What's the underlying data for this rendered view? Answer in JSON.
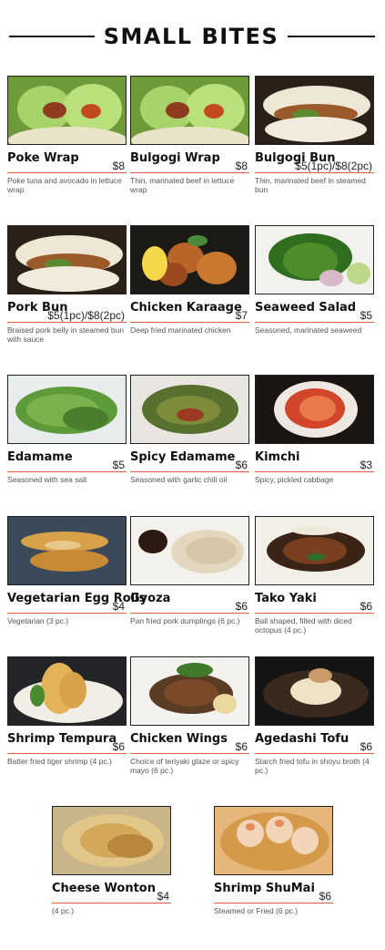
{
  "header": {
    "title": "SMALL BITES"
  },
  "items": [
    {
      "name": "Poke Wrap",
      "price": "$8",
      "desc": "Poke tuna and avocado in lettuce wrap",
      "photo": "lettuce-wraps-photo"
    },
    {
      "name": "Bulgogi Wrap",
      "price": "$8",
      "desc": "Thin, marinated beef in lettuce wrap",
      "photo": "lettuce-wraps-photo"
    },
    {
      "name": "Bulgogi Bun",
      "price": "$5(1pc)/$8(2pc)",
      "desc": "Thin, marinated beef in steamed bun",
      "photo": "steamed-bun-photo"
    },
    {
      "name": "Pork Bun",
      "price": "$5(1pc)/$8(2pc)",
      "desc": "Braised pork belly in steamed bun with sauce",
      "photo": "steamed-bun-photo"
    },
    {
      "name": "Chicken Karaage",
      "price": "$7",
      "desc": "Deep fried marinated chicken",
      "photo": "fried-chicken-photo"
    },
    {
      "name": "Seaweed Salad",
      "price": "$5",
      "desc": "Seasoned, marinated seaweed",
      "photo": "seaweed-salad-photo"
    },
    {
      "name": "Edamame",
      "price": "$5",
      "desc": "Seasoned with sea salt",
      "photo": "edamame-photo"
    },
    {
      "name": "Spicy Edamame",
      "price": "$6",
      "desc": "Seasoned with garlic chili oil",
      "photo": "spicy-edamame-photo"
    },
    {
      "name": "Kimchi",
      "price": "$3",
      "desc": "Spicy, pickled cabbage",
      "photo": "kimchi-photo"
    },
    {
      "name": "Vegetarian Egg Rolls",
      "price": "$4",
      "desc": "Vegetarian (3 pc.)",
      "photo": "egg-rolls-photo"
    },
    {
      "name": "Gyoza",
      "price": "$6",
      "desc": "Pan fried pork dumplings (6 pc.)",
      "photo": "gyoza-photo"
    },
    {
      "name": "Tako Yaki",
      "price": "$6",
      "desc": "Ball shaped, filled with diced octopus (4 pc.)",
      "photo": "takoyaki-photo"
    },
    {
      "name": "Shrimp Tempura",
      "price": "$6",
      "desc": "Batter fried tiger shrimp (4 pc.)",
      "photo": "tempura-photo"
    },
    {
      "name": "Chicken Wings",
      "price": "$6",
      "desc": "Choice of teriyaki glaze or spicy mayo (6 pc.)",
      "photo": "chicken-wings-photo"
    },
    {
      "name": "Agedashi Tofu",
      "price": "$6",
      "desc": "Starch fried tofu in shoyu broth (4 pc.)",
      "photo": "agedashi-tofu-photo"
    },
    {
      "name": "Cheese Wonton",
      "price": "$4",
      "desc": "(4 pc.)",
      "photo": "wontons-photo"
    },
    {
      "name": "Shrimp ShuMai",
      "price": "$6",
      "desc": "Steamed or Fried (6 pc.)",
      "photo": "shumai-photo"
    }
  ],
  "colors": {
    "accent_rule": "#d9623a",
    "text": "#111111",
    "desc_text": "#555555"
  }
}
